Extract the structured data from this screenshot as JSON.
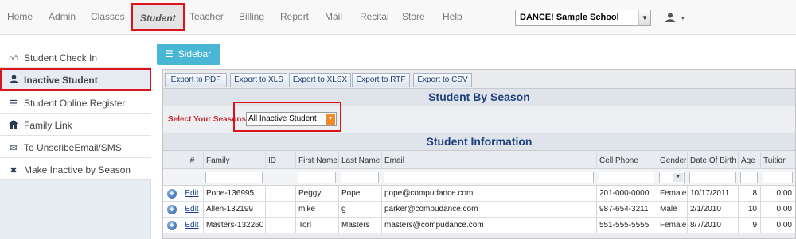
{
  "nav": {
    "items": [
      "Home",
      "Admin",
      "Classes",
      "Student",
      "Teacher",
      "Billing",
      "Report",
      "Mail",
      "Recital",
      "Store",
      "Help"
    ],
    "active": "Student",
    "school_selected": "DANCE! Sample School"
  },
  "sidebar": {
    "items": [
      {
        "label": "Student Check In",
        "icon": "thumbs-up-icon"
      },
      {
        "label": "Inactive Student",
        "icon": "user-icon"
      },
      {
        "label": "Student Online Register",
        "icon": "list-icon"
      },
      {
        "label": "Family Link",
        "icon": "home-icon"
      },
      {
        "label": "To UnscribeEmail/SMS",
        "icon": "envelope-icon"
      },
      {
        "label": "Make Inactive by Season",
        "icon": "close-icon"
      }
    ],
    "active": "Inactive Student",
    "toggle_label": "Sidebar"
  },
  "exports": [
    "Export to PDF",
    "Export to XLS",
    "Export to XLSX",
    "Export to RTF",
    "Export to CSV"
  ],
  "season": {
    "title": "Student By Season",
    "label": "Select Your Seasons:",
    "selected": "All Inactive Student"
  },
  "grid": {
    "title": "Student Information",
    "columns": [
      "#",
      "Family",
      "ID",
      "First Name",
      "Last Name",
      "Email",
      "Cell Phone",
      "Gender",
      "Date Of Birth",
      "Age",
      "Tuition"
    ],
    "rows": [
      {
        "action": "Edit",
        "family": "Pope-136995",
        "id": "",
        "first": "Peggy",
        "last": "Pope",
        "email": "pope@compudance.com",
        "phone": "201-000-0000",
        "gender": "Female",
        "dob": "10/17/2011",
        "age": "8",
        "tuition": "0.00"
      },
      {
        "action": "Edit",
        "family": "Allen-132199",
        "id": "",
        "first": "mike",
        "last": "g",
        "email": "parker@compudance.com",
        "phone": "987-654-3211",
        "gender": "Male",
        "dob": "2/1/2010",
        "age": "10",
        "tuition": "0.00"
      },
      {
        "action": "Edit",
        "family": "Masters-132260",
        "id": "",
        "first": "Tori",
        "last": "Masters",
        "email": "masters@compudance.com",
        "phone": "551-555-5555",
        "gender": "Female",
        "dob": "8/7/2010",
        "age": "9",
        "tuition": "0.00"
      }
    ]
  },
  "colors": {
    "accent": "#4ab6d6",
    "highlight": "#d9141c",
    "header_text": "#1e3f7a",
    "label_red": "#c6262e",
    "dropdown_orange": "#f08a27"
  }
}
